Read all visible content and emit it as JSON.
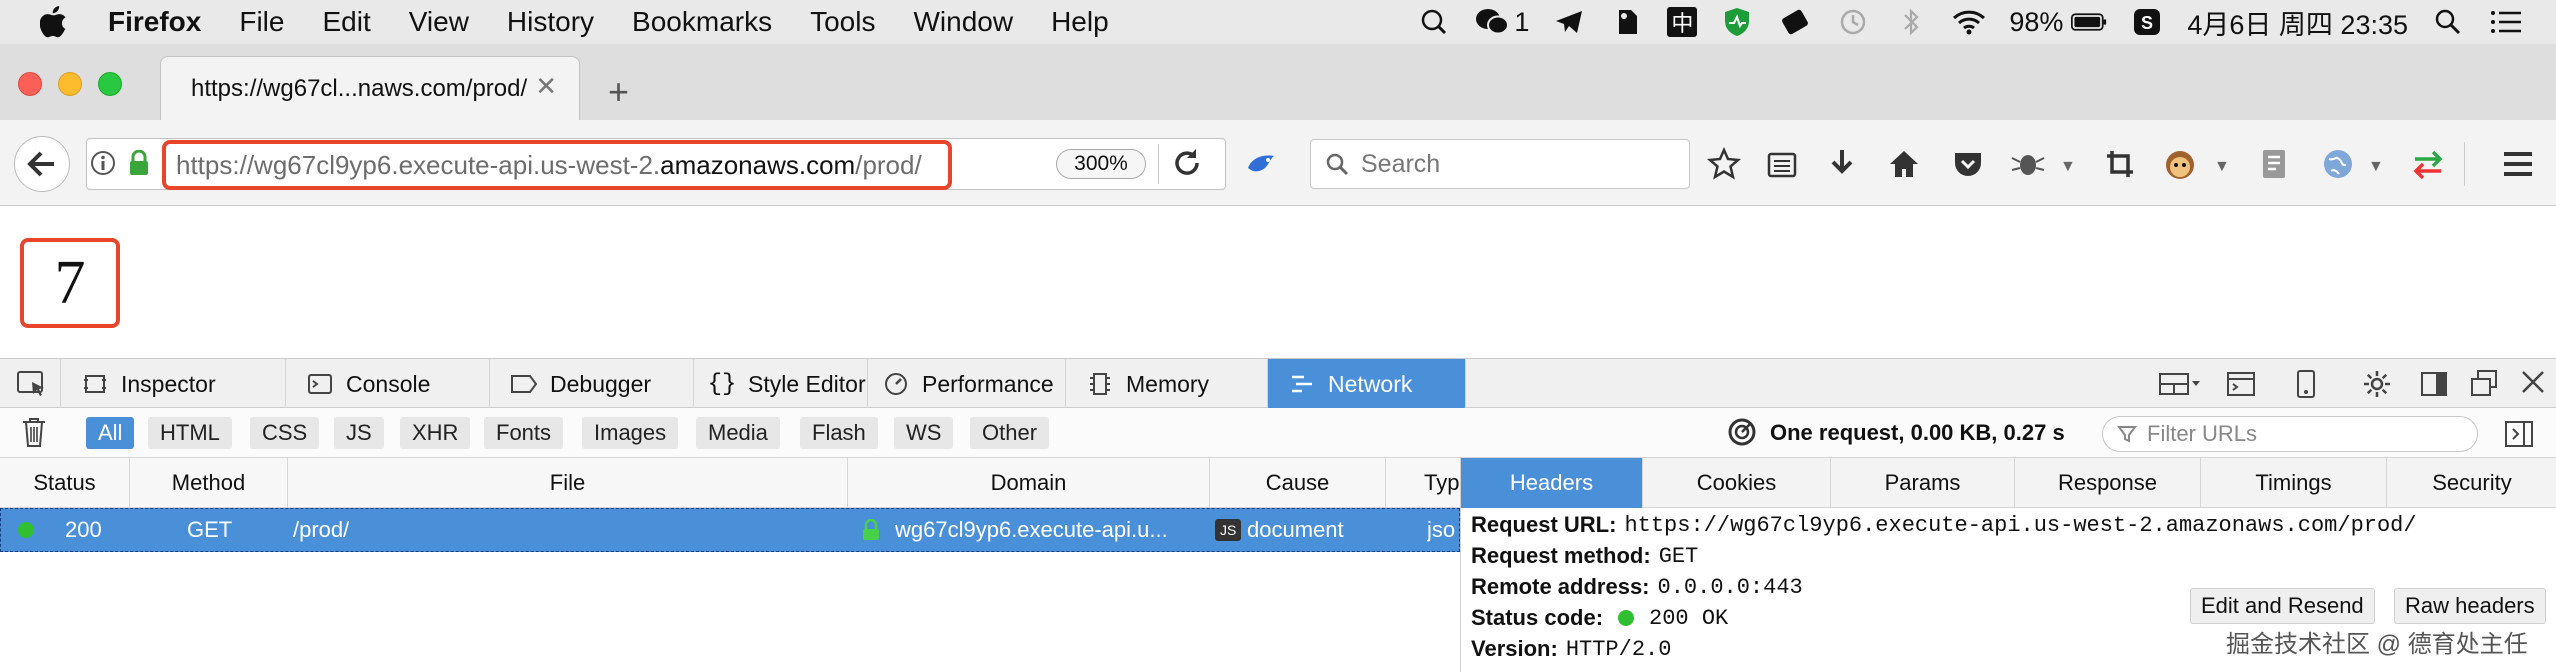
{
  "menubar": {
    "app": "Firefox",
    "items": [
      "File",
      "Edit",
      "View",
      "History",
      "Bookmarks",
      "Tools",
      "Window",
      "Help"
    ],
    "tray": {
      "wechat_badge": "1",
      "input_method": "中",
      "battery": "98%",
      "datetime": "4月6日 周四  23:35"
    }
  },
  "browser": {
    "tab_title": "https://wg67cl...naws.com/prod/",
    "url_prefix": "https://wg67cl9yp6.execute-api.us-west-2.",
    "url_domain": "amazonaws.com",
    "url_suffix": "/prod/",
    "zoom": "300%",
    "search_placeholder": "Search"
  },
  "page": {
    "content": "7"
  },
  "devtools": {
    "tabs": [
      "Inspector",
      "Console",
      "Debugger",
      "Style Editor",
      "Performance",
      "Memory",
      "Network"
    ],
    "active_tab": "Network",
    "filters": [
      "All",
      "HTML",
      "CSS",
      "JS",
      "XHR",
      "Fonts",
      "Images",
      "Media",
      "Flash",
      "WS",
      "Other"
    ],
    "summary": "One request, 0.00 KB, 0.27 s",
    "filter_placeholder": "Filter URLs",
    "columns": [
      "Status",
      "Method",
      "File",
      "Domain",
      "Cause",
      "Typ"
    ],
    "request": {
      "status": "200",
      "method": "GET",
      "file": "/prod/",
      "domain": "wg67cl9yp6.execute-api.u...",
      "cause_badge": "JS",
      "cause": "document",
      "type": "jso"
    },
    "panel_tabs": [
      "Headers",
      "Cookies",
      "Params",
      "Response",
      "Timings",
      "Security"
    ],
    "headers": {
      "request_url_label": "Request URL:",
      "request_url": "https://wg67cl9yp6.execute-api.us-west-2.amazonaws.com/prod/",
      "method_label": "Request method:",
      "method": "GET",
      "remote_label": "Remote address:",
      "remote": "0.0.0.0:443",
      "status_label": "Status code:",
      "status": "200 OK",
      "version_label": "Version:",
      "version": "HTTP/2.0"
    },
    "edit_resend": "Edit and Resend",
    "raw_headers": "Raw headers"
  },
  "watermark": "掘金技术社区 @ 德育处主任",
  "colors": {
    "accent": "#4a90d9",
    "highlight_border": "#e8452b",
    "ok_green": "#2fbf2f",
    "lock_green": "#3aa63a"
  }
}
